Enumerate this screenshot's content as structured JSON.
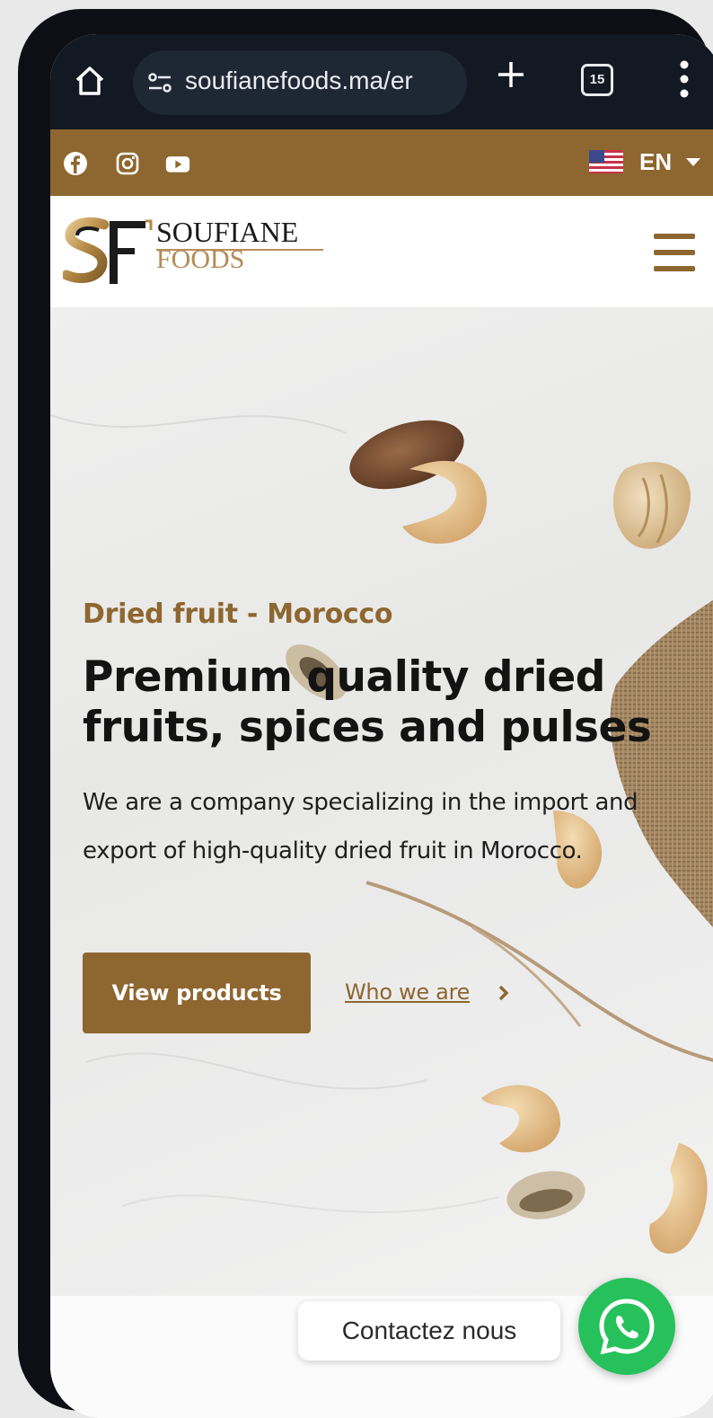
{
  "browser": {
    "url": "soufianefoods.ma/er",
    "tab_count": "15"
  },
  "topbar": {
    "socials": [
      "facebook-icon",
      "instagram-icon",
      "youtube-icon"
    ],
    "language": "EN"
  },
  "logo": {
    "line1": "SOUFIANE",
    "line2": "FOODS"
  },
  "hero": {
    "eyebrow": "Dried fruit - Morocco",
    "headline": "Premium quality dried fruits, spices and pulses",
    "description": "We are a company specializing in the import and export of high-quality dried fruit in Morocco.",
    "primary_button": "View products",
    "secondary_link": "Who we are"
  },
  "contact": {
    "label": "Contactez nous"
  },
  "colors": {
    "brand_brown": "#8e6630",
    "whatsapp_green": "#26c15b",
    "browser_bg": "#121923"
  }
}
